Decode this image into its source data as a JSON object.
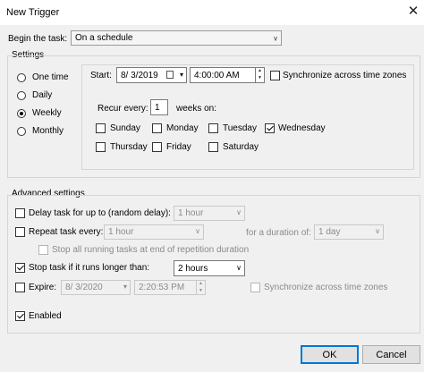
{
  "window": {
    "title": "New Trigger",
    "close_icon": "✕"
  },
  "begin_task": {
    "label": "Begin the task:",
    "value": "On a schedule"
  },
  "settings": {
    "label": "Settings",
    "radios": [
      {
        "label": "One time",
        "checked": false
      },
      {
        "label": "Daily",
        "checked": false
      },
      {
        "label": "Weekly",
        "checked": true
      },
      {
        "label": "Monthly",
        "checked": false
      }
    ],
    "start_label": "Start:",
    "start_date": "8/  3/2019",
    "start_time": "4:00:00 AM",
    "sync_label": "Synchronize across time zones",
    "recur_label": "Recur every:",
    "recur_value": "1",
    "weeks_on_label": "weeks on:",
    "days": [
      {
        "label": "Sunday",
        "checked": false
      },
      {
        "label": "Monday",
        "checked": false
      },
      {
        "label": "Tuesday",
        "checked": false
      },
      {
        "label": "Wednesday",
        "checked": true
      },
      {
        "label": "Thursday",
        "checked": false
      },
      {
        "label": "Friday",
        "checked": false
      },
      {
        "label": "Saturday",
        "checked": false
      }
    ]
  },
  "advanced": {
    "label": "Advanced settings",
    "delay_label": "Delay task for up to (random delay):",
    "delay_value": "1 hour",
    "repeat_label": "Repeat task every:",
    "repeat_value": "1 hour",
    "duration_label": "for a duration of:",
    "duration_value": "1 day",
    "stop_all_label": "Stop all running tasks at end of repetition duration",
    "stop_label": "Stop task if it runs longer than:",
    "stop_value": "2 hours",
    "expire_label": "Expire:",
    "expire_date": "8/  3/2020",
    "expire_time": "2:20:53 PM",
    "expire_sync_label": "Synchronize across time zones",
    "enabled_label": "Enabled"
  },
  "buttons": {
    "ok": "OK",
    "cancel": "Cancel"
  }
}
